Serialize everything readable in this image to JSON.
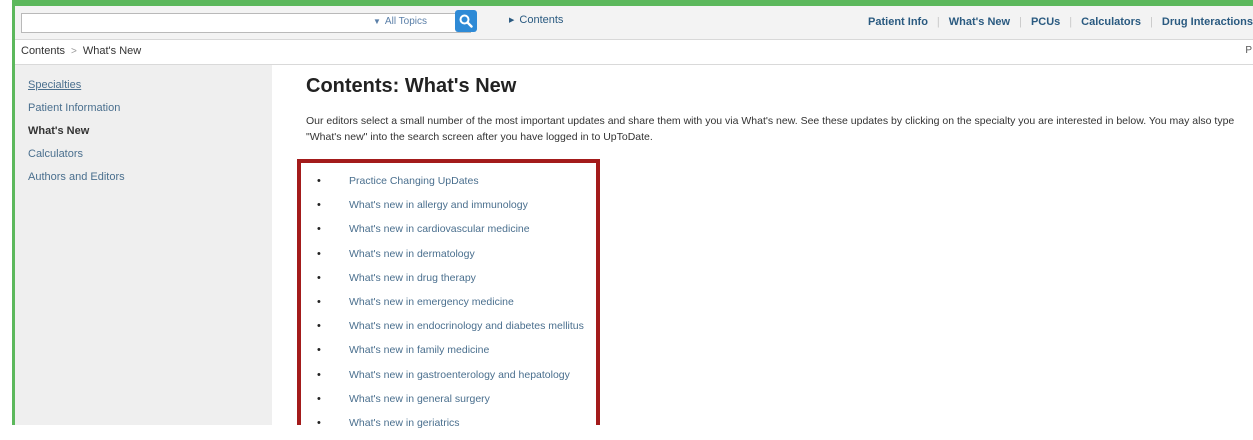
{
  "search": {
    "placeholder": "",
    "value": "",
    "topics_label": "All Topics",
    "button_icon": "search-icon"
  },
  "header": {
    "contents_label": "Contents",
    "nav": [
      "Patient Info",
      "What's New",
      "PCUs",
      "Calculators",
      "Drug Interactions"
    ]
  },
  "breadcrumb": {
    "items": [
      "Contents",
      "What's New"
    ],
    "separator": ">",
    "right_text": "P"
  },
  "sidebar": {
    "items": [
      {
        "label": "Specialties",
        "active": false
      },
      {
        "label": "Patient Information",
        "active": false
      },
      {
        "label": "What's New",
        "active": true
      },
      {
        "label": "Calculators",
        "active": false
      },
      {
        "label": "Authors and Editors",
        "active": false
      }
    ]
  },
  "main": {
    "title": "Contents: What's New",
    "intro": "Our editors select a small number of the most important updates and share them with you via What's new. See these updates by clicking on the specialty you are interested in below. You may also type \"What's new\" into the search screen after you have logged in to UpToDate.",
    "links": [
      "Practice Changing UpDates",
      "What's new in allergy and immunology",
      "What's new in cardiovascular medicine",
      "What's new in dermatology",
      "What's new in drug therapy",
      "What's new in emergency medicine",
      "What's new in endocrinology and diabetes mellitus",
      "What's new in family medicine",
      "What's new in gastroenterology and hepatology",
      "What's new in general surgery",
      "What's new in geriatrics"
    ]
  },
  "colors": {
    "frame": "#5cb85c",
    "highlight_box": "#a31b1b",
    "link": "#4a6f8e",
    "search_button": "#2e8ad6"
  }
}
